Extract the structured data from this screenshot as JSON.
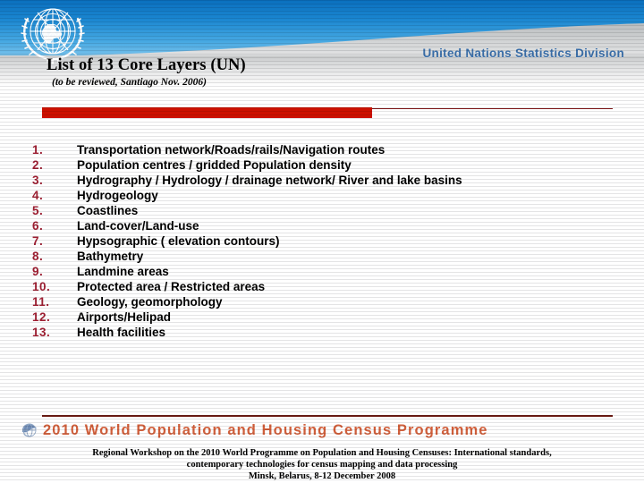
{
  "header": {
    "emblem_icon": "un-emblem-icon",
    "division_label": "United Nations Statistics Division",
    "gradient_top_color": "#0a6fbe",
    "gradient_bottom_color": "#cbe7f8"
  },
  "title": {
    "main": "List of 13 Core Layers (UN)",
    "subtitle": "(to be reviewed, Santiago Nov. 2006)"
  },
  "accent": {
    "bar_color": "#cc1100",
    "line_color": "#7b1414"
  },
  "list": {
    "number_color": "#9e1f32",
    "items": [
      {
        "number": "1.",
        "label": "Transportation network/Roads/rails/Navigation routes"
      },
      {
        "number": "2.",
        "label": "Population centres  / gridded Population density"
      },
      {
        "number": "3.",
        "label": "Hydrography / Hydrology / drainage network/ River and lake basins"
      },
      {
        "number": "4.",
        "label": "Hydrogeology"
      },
      {
        "number": "5.",
        "label": "Coastlines"
      },
      {
        "number": "6.",
        "label": "Land-cover/Land-use"
      },
      {
        "number": "7.",
        "label": "Hypsographic ( elevation contours)"
      },
      {
        "number": "8.",
        "label": "Bathymetry"
      },
      {
        "number": "9.",
        "label": "Landmine areas"
      },
      {
        "number": "10.",
        "label": "Protected area / Restricted areas"
      },
      {
        "number": "11.",
        "label": "Geology, geomorphology"
      },
      {
        "number": "12.",
        "label": "Airports/Helipad"
      },
      {
        "number": "13.",
        "label": "Health facilities"
      }
    ]
  },
  "footer": {
    "banner_icon": "census-globe-icon",
    "banner_text": "2010 World Population and Housing Census Programme",
    "banner_text_color": "#d2603c",
    "rule_color": "#6e1b14",
    "line1": "Regional Workshop on the 2010 World Programme on Population and Housing Censuses: International standards,",
    "line2": "contemporary technologies for census mapping and data processing",
    "line3": "Minsk, Belarus, 8-12 December 2008"
  }
}
